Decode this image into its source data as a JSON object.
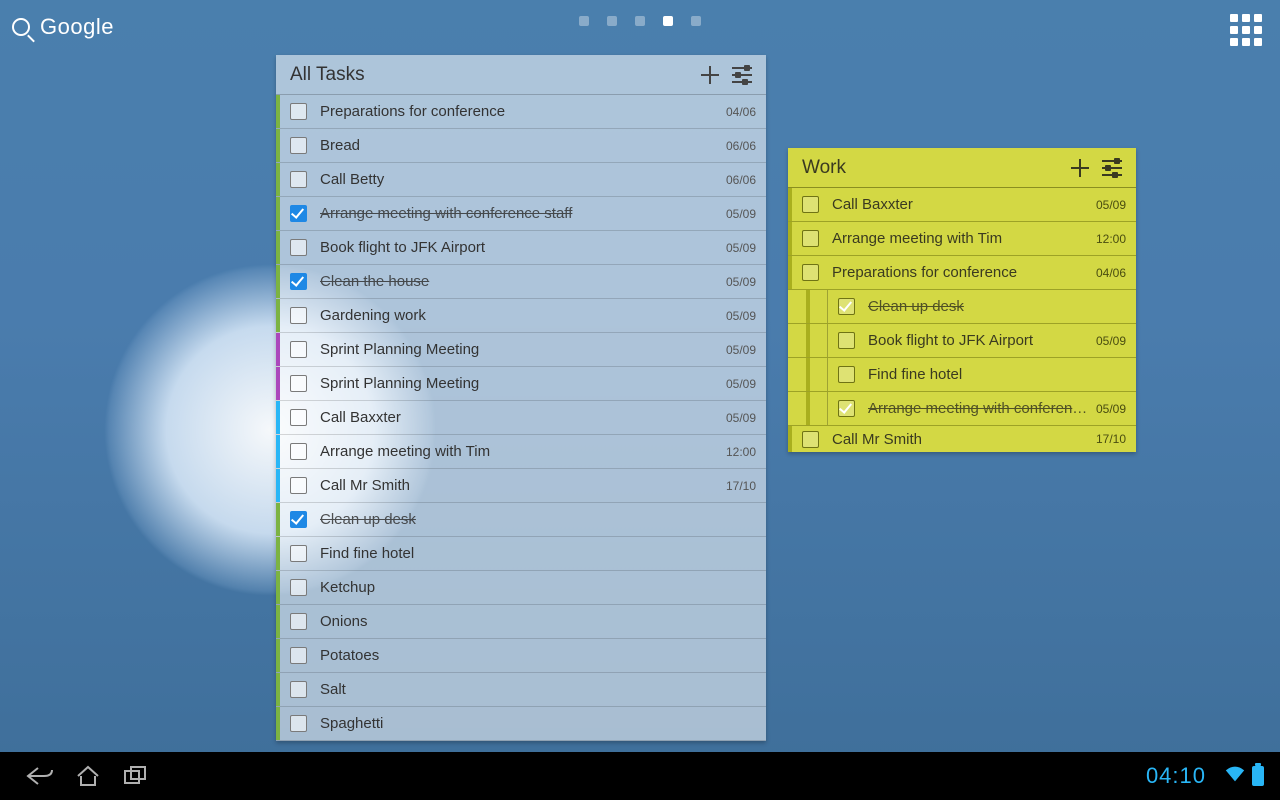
{
  "topbar": {
    "search_label": "Google"
  },
  "statusbar": {
    "time": "04:10"
  },
  "widgets": {
    "all": {
      "title": "All Tasks",
      "items": [
        {
          "label": "Preparations for conference",
          "date": "04/06",
          "checked": false,
          "stripe": "#7cb342",
          "indent": 0,
          "done": false
        },
        {
          "label": "Bread",
          "date": "06/06",
          "checked": false,
          "stripe": "#7cb342",
          "indent": 0,
          "done": false
        },
        {
          "label": "Call Betty",
          "date": "06/06",
          "checked": false,
          "stripe": "#7cb342",
          "indent": 0,
          "done": false
        },
        {
          "label": "Arrange meeting with conference staff",
          "date": "05/09",
          "checked": true,
          "stripe": "#7cb342",
          "indent": 0,
          "done": true
        },
        {
          "label": "Book flight to JFK Airport",
          "date": "05/09",
          "checked": false,
          "stripe": "#7cb342",
          "indent": 0,
          "done": false
        },
        {
          "label": "Clean the house",
          "date": "05/09",
          "checked": true,
          "stripe": "#7cb342",
          "indent": 0,
          "done": true
        },
        {
          "label": "Gardening work",
          "date": "05/09",
          "checked": false,
          "stripe": "#7cb342",
          "indent": 0,
          "done": false
        },
        {
          "label": "Sprint Planning Meeting",
          "date": "05/09",
          "checked": false,
          "stripe": "#ab47bc",
          "indent": 0,
          "done": false
        },
        {
          "label": "Sprint Planning Meeting",
          "date": "05/09",
          "checked": false,
          "stripe": "#ab47bc",
          "indent": 0,
          "done": false
        },
        {
          "label": "Call Baxxter",
          "date": "05/09",
          "checked": false,
          "stripe": "#29b6f6",
          "indent": 0,
          "done": false
        },
        {
          "label": "Arrange meeting with Tim",
          "date": "12:00",
          "checked": false,
          "stripe": "#29b6f6",
          "indent": 0,
          "done": false
        },
        {
          "label": "Call Mr Smith",
          "date": "17/10",
          "checked": false,
          "stripe": "#29b6f6",
          "indent": 0,
          "done": false
        },
        {
          "label": "Clean up desk",
          "date": "",
          "checked": true,
          "stripe": "#7cb342",
          "indent": 0,
          "done": true
        },
        {
          "label": "Find fine hotel",
          "date": "",
          "checked": false,
          "stripe": "#7cb342",
          "indent": 0,
          "done": false
        },
        {
          "label": "Ketchup",
          "date": "",
          "checked": false,
          "stripe": "#7cb342",
          "indent": 0,
          "done": false
        },
        {
          "label": "Onions",
          "date": "",
          "checked": false,
          "stripe": "#7cb342",
          "indent": 0,
          "done": false
        },
        {
          "label": "Potatoes",
          "date": "",
          "checked": false,
          "stripe": "#7cb342",
          "indent": 0,
          "done": false
        },
        {
          "label": "Salt",
          "date": "",
          "checked": false,
          "stripe": "#7cb342",
          "indent": 0,
          "done": false
        },
        {
          "label": "Spaghetti",
          "date": "",
          "checked": false,
          "stripe": "#7cb342",
          "indent": 0,
          "done": false
        }
      ]
    },
    "work": {
      "title": "Work",
      "items": [
        {
          "label": "Call Baxxter",
          "date": "05/09",
          "checked": false,
          "indent": 0,
          "done": false
        },
        {
          "label": "Arrange meeting with Tim",
          "date": "12:00",
          "checked": false,
          "indent": 0,
          "done": false
        },
        {
          "label": "Preparations for conference",
          "date": "04/06",
          "checked": false,
          "indent": 0,
          "done": false
        },
        {
          "label": "Clean up desk",
          "date": "",
          "checked": true,
          "indent": 1,
          "done": true
        },
        {
          "label": "Book flight to JFK Airport",
          "date": "05/09",
          "checked": false,
          "indent": 1,
          "done": false
        },
        {
          "label": "Find fine hotel",
          "date": "",
          "checked": false,
          "indent": 1,
          "done": false
        },
        {
          "label": "Arrange meeting with conferenc…",
          "date": "05/09",
          "checked": true,
          "indent": 1,
          "done": true
        },
        {
          "label": "Call Mr Smith",
          "date": "17/10",
          "checked": false,
          "indent": 0,
          "done": false,
          "cut": true
        }
      ]
    }
  }
}
